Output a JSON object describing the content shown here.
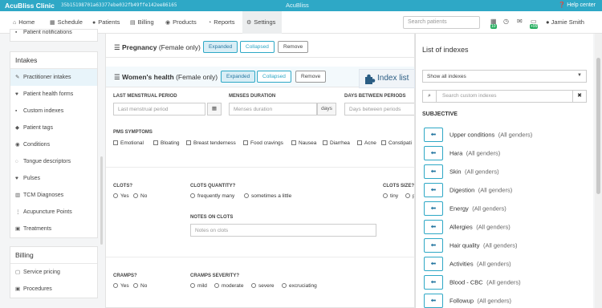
{
  "topbar": {
    "brand": "AcuBliss Clinic",
    "hash": "35b15198701a63377ebe032fb49ffe142ee86165",
    "center": "AcuBliss",
    "help": "Help center"
  },
  "nav": {
    "items": [
      {
        "label": "Home"
      },
      {
        "label": "Schedule"
      },
      {
        "label": "Patients"
      },
      {
        "label": "Billing"
      },
      {
        "label": "Products"
      },
      {
        "label": "Reports"
      },
      {
        "label": "Settings"
      }
    ],
    "search_placeholder": "Search patients",
    "badge1": "10",
    "badge2": "+99",
    "user": "Jamie Smith"
  },
  "sidebar": {
    "top_item": "Patient notifications",
    "intakes_title": "Intakes",
    "intakes": [
      {
        "label": "Practitioner intakes"
      },
      {
        "label": "Patient health forms"
      },
      {
        "label": "Custom indexes"
      },
      {
        "label": "Patient tags"
      },
      {
        "label": "Conditions"
      },
      {
        "label": "Tongue descriptors"
      },
      {
        "label": "Pulses"
      },
      {
        "label": "TCM Diagnoses"
      },
      {
        "label": "Acupuncture Points"
      },
      {
        "label": "Treatments"
      }
    ],
    "billing_title": "Billing",
    "billing": [
      {
        "label": "Service pricing"
      },
      {
        "label": "Procedures"
      }
    ]
  },
  "main": {
    "pregnancy": {
      "title": "Pregnancy",
      "sub": "(Female only)"
    },
    "womens": {
      "title": "Women's health",
      "sub": "(Female only)"
    },
    "expanded": "Expanded",
    "collapsed": "Collapsed",
    "remove": "Remove",
    "lmp_label": "LAST MENSTRUAL PERIOD",
    "lmp_placeholder": "Last menstrual period",
    "menses_label": "MENSES DURATION",
    "menses_placeholder": "Menses duration",
    "days": "days",
    "between_label": "DAYS BETWEEN PERIODS",
    "between_placeholder": "Days between periods",
    "pms_label": "PMS SYMPTOMS",
    "pms": [
      "Emotional",
      "Bloating",
      "Breast tenderness",
      "Food cravings",
      "Nausea",
      "Diarrhea",
      "Acne",
      "Constipati"
    ],
    "clots_label": "CLOTS?",
    "yes": "Yes",
    "no": "No",
    "clots_qty_label": "CLOTS QUANTITY?",
    "clots_qty": [
      "frequently many",
      "sometimes a little"
    ],
    "clots_size_label": "CLOTS SIZE?",
    "clots_size": [
      "tiny",
      "p"
    ],
    "notes_label": "NOTES ON CLOTS",
    "notes_placeholder": "Notes on clots",
    "cramps_label": "CRAMPS?",
    "cramps_sev_label": "CRAMPS SEVERITY?",
    "cramps_sev": [
      "mild",
      "moderate",
      "severe",
      "excruciating"
    ]
  },
  "index_button": "Index list",
  "panel": {
    "title": "List of indexes",
    "select": "Show all indexes",
    "search_placeholder": "Search custom indexes",
    "section": "SUBJECTIVE",
    "items": [
      {
        "name": "Upper conditions",
        "scope": "(All genders)"
      },
      {
        "name": "Hara",
        "scope": "(All genders)"
      },
      {
        "name": "Skin",
        "scope": "(All genders)"
      },
      {
        "name": "Digestion",
        "scope": "(All genders)"
      },
      {
        "name": "Energy",
        "scope": "(All genders)"
      },
      {
        "name": "Allergies",
        "scope": "(All genders)"
      },
      {
        "name": "Hair quality",
        "scope": "(All genders)"
      },
      {
        "name": "Activities",
        "scope": "(All genders)"
      },
      {
        "name": "Blood - CBC",
        "scope": "(All genders)"
      },
      {
        "name": "Followup",
        "scope": "(All genders)"
      }
    ]
  }
}
